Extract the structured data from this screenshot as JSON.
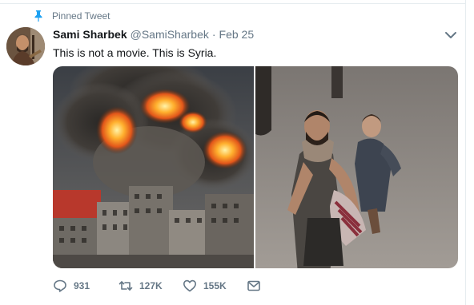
{
  "pinned_label": "Pinned Tweet",
  "user": {
    "name": "Sami Sharbek",
    "handle": "@SamiSharbek",
    "separator": "·",
    "date": "Feb 25"
  },
  "tweet_text": "This is not a movie. This is Syria.",
  "actions": {
    "replies": "931",
    "retweets": "127K",
    "likes": "155K"
  },
  "colors": {
    "accent": "#1da1f2",
    "muted": "#657786",
    "text": "#14171a",
    "border": "#e6ecf0"
  },
  "icons": [
    "pin-icon",
    "chevron-down-icon",
    "reply-icon",
    "retweet-icon",
    "like-icon",
    "message-icon"
  ]
}
